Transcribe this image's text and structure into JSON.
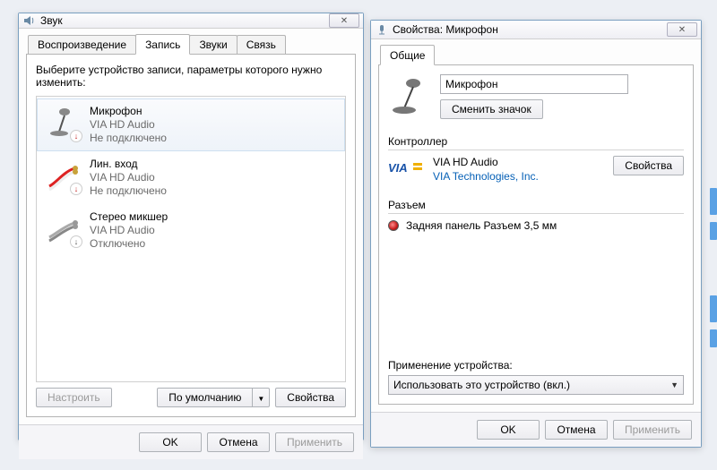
{
  "left_dialog": {
    "title": "Звук",
    "tabs": {
      "playback": "Воспроизведение",
      "record": "Запись",
      "sounds": "Звуки",
      "comm": "Связь"
    },
    "instruction": "Выберите устройство записи, параметры которого нужно изменить:",
    "devices": [
      {
        "name": "Микрофон",
        "sub": "VIA HD Audio",
        "status": "Не подключено",
        "icon": "mic",
        "badge": "red-down"
      },
      {
        "name": "Лин. вход",
        "sub": "VIA HD Audio",
        "status": "Не подключено",
        "icon": "linein",
        "badge": "red-down"
      },
      {
        "name": "Стерео микшер",
        "sub": "VIA HD Audio",
        "status": "Отключено",
        "icon": "mixer",
        "badge": "gray-down"
      }
    ],
    "btn_configure": "Настроить",
    "btn_default": "По умолчанию",
    "btn_properties": "Свойства",
    "ok": "OK",
    "cancel": "Отмена",
    "apply": "Применить"
  },
  "right_dialog": {
    "title": "Свойства: Микрофон",
    "tabs": {
      "general": "Общие"
    },
    "name_value": "Микрофон",
    "btn_change_icon": "Сменить значок",
    "controller_label": "Контроллер",
    "controller_name": "VIA HD Audio",
    "vendor_link": "VIA Technologies, Inc.",
    "btn_ctrl_props": "Свойства",
    "jack_label": "Разъем",
    "jack_text": "Задняя панель Разъем 3,5 мм",
    "usage_label": "Применение устройства:",
    "usage_value": "Использовать это устройство (вкл.)",
    "ok": "OK",
    "cancel": "Отмена",
    "apply": "Применить"
  }
}
